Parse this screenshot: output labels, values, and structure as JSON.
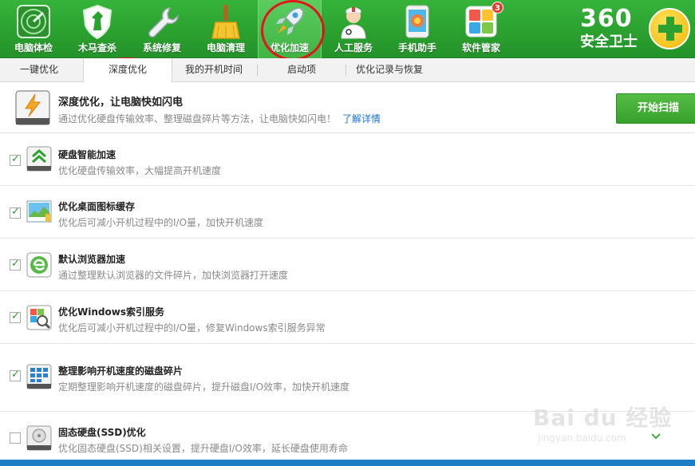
{
  "toolbar": {
    "items": [
      {
        "label": "电脑体检",
        "icon": "radar-icon"
      },
      {
        "label": "木马查杀",
        "icon": "horse-shield-icon"
      },
      {
        "label": "系统修复",
        "icon": "wrench-icon"
      },
      {
        "label": "电脑清理",
        "icon": "broom-icon"
      },
      {
        "label": "优化加速",
        "icon": "rocket-icon",
        "active": true
      },
      {
        "label": "人工服务",
        "icon": "doctor-icon"
      },
      {
        "label": "手机助手",
        "icon": "phone-icon"
      },
      {
        "label": "软件管家",
        "icon": "apps-icon",
        "badge": "3"
      }
    ],
    "brand": {
      "number": "360",
      "name": "安全卫士"
    }
  },
  "tabs": [
    {
      "label": "一键优化"
    },
    {
      "label": "深度优化",
      "active": true
    },
    {
      "label": "我的开机时间"
    },
    {
      "label": "启动项"
    },
    {
      "label": "优化记录与恢复"
    }
  ],
  "header": {
    "title": "深度优化，让电脑快如闪电",
    "desc": "通过优化硬盘传输效率、整理磁盘碎片等方法，让电脑快如闪电！",
    "link": "了解详情",
    "scan_button": "开始扫描",
    "icon": "lightning-disk-icon"
  },
  "items": [
    {
      "title": "硬盘智能加速",
      "desc": "优化硬盘传输效率，大幅提高开机速度",
      "checked": true,
      "icon": "disk-speed-icon"
    },
    {
      "title": "优化桌面图标缓存",
      "desc": "优化后可减小开机过程中的I/O量，加快开机速度",
      "checked": true,
      "icon": "desktop-chart-icon"
    },
    {
      "title": "默认浏览器加速",
      "desc": "通过整理默认浏览器的文件碎片，加快浏览器打开速度",
      "checked": true,
      "icon": "browser-icon"
    },
    {
      "title": "优化Windows索引服务",
      "desc": "优化后可减小开机过程中的I/O量，修复Windows索引服务异常",
      "checked": true,
      "icon": "search-index-icon"
    },
    {
      "title": "整理影响开机速度的磁盘碎片",
      "desc": "定期整理影响开机速度的磁盘碎片，提升磁盘I/O效率，加快开机速度",
      "checked": true,
      "icon": "defrag-icon"
    },
    {
      "title": "固态硬盘(SSD)优化",
      "desc": "优化固态硬盘(SSD)相关设置，提升硬盘I/O效率，延长硬盘使用寿命",
      "checked": false,
      "icon": "ssd-icon"
    }
  ],
  "watermark": {
    "logo": "Bai du 经验",
    "url": "jingyan.baidu.com"
  },
  "colors": {
    "brand_green": "#2ba12f",
    "link_blue": "#1a73d9",
    "annotation_red": "#e3141a"
  }
}
